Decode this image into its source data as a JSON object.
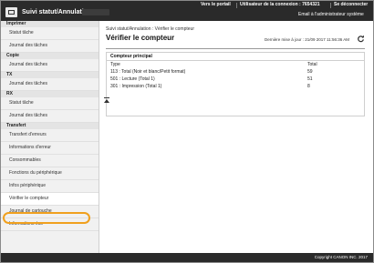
{
  "header": {
    "app_title": "Suivi statut/Annulation",
    "portal_link": "Vers le portail",
    "user_label": "Utilisateur de la connexion :",
    "user_value": "7654321",
    "logout_link": "Se déconnecter",
    "email_admin_link": "Email à l'administrateur système"
  },
  "sidebar": {
    "sections": [
      {
        "title": "Imprimer",
        "items": [
          "Statut tâche",
          "Journal des tâches"
        ]
      },
      {
        "title": "Copie",
        "items": [
          "Journal des tâches"
        ]
      },
      {
        "title": "TX",
        "items": [
          "Journal des tâches"
        ]
      },
      {
        "title": "RX",
        "items": [
          "Statut tâche",
          "Journal des tâches"
        ]
      },
      {
        "title": "Transfert",
        "items": [
          "Transfert d'erreurs",
          "Informations d'erreur",
          "Consommables",
          "Fonctions du périphérique",
          "Infos périphérique",
          "Vérifier le compteur",
          "Journal de cartouche",
          "Informations éco"
        ]
      }
    ],
    "active_item": "Vérifier le compteur"
  },
  "main": {
    "breadcrumb": "Suivi statut/Annulation : Vérifier le compteur",
    "title": "Vérifier le compteur",
    "last_update": "Dernière mise à jour : 21/09 2017 11:56:36 AM",
    "panel": {
      "title": "Compteur principal",
      "col_type": "Type",
      "col_total": "Total",
      "rows": [
        {
          "type": "113 : Total (Noir et blanc/Petit format)",
          "total": "59"
        },
        {
          "type": "501 : Lecture (Total 1)",
          "total": "51"
        },
        {
          "type": "301 : Impression (Total 1)",
          "total": "8"
        }
      ]
    }
  },
  "footer": {
    "copyright": "Copyright CANON INC. 2017"
  },
  "colors": {
    "header_bg": "#2a2a2a",
    "highlight": "#f0a01e",
    "sidebar_bg": "#f1f1f1"
  },
  "icons": [
    "refresh-icon",
    "scroll-top-icon",
    "logo-icon"
  ]
}
